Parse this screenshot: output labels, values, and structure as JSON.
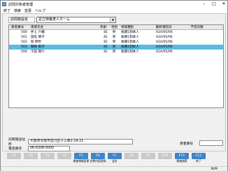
{
  "window": {
    "title": "訪問対象者管理"
  },
  "menu": [
    "終了",
    "検索",
    "変更",
    "ヘルプ"
  ],
  "facility": {
    "label": "訪問施設名",
    "value": "足立特養老人ホーム"
  },
  "grid": {
    "columns": [
      "患者番号",
      "患者氏名",
      "年齢",
      "性別",
      "保険種別",
      "最終来院日",
      "予定日数"
    ],
    "rows": [
      {
        "id": "500",
        "name": "井上 六輔",
        "age": "81",
        "sex": "男",
        "ins": "後期1割本人",
        "last": "H24/05/06",
        "next": ""
      },
      {
        "id": "501",
        "name": "田島 節子",
        "age": "81",
        "sex": "男",
        "ins": "後期1割本人",
        "last": "H24/05/06",
        "next": ""
      },
      {
        "id": "502",
        "name": "堀 明世",
        "age": "81",
        "sex": "男",
        "ins": "後期1割本人",
        "last": "H24/05/06",
        "next": ""
      },
      {
        "id": "503",
        "name": "関根 恵子",
        "age": "81",
        "sex": "男",
        "ins": "後期1割本人",
        "last": "H24/05/06",
        "next": ""
      },
      {
        "id": "504",
        "name": "千田 陽介",
        "age": "81",
        "sex": "男",
        "ins": "後期1割本人",
        "last": "H24/05/06",
        "next": ""
      }
    ],
    "selected_index": 3
  },
  "info": {
    "address_label": "訪問施設住所",
    "address_value": "大阪府大阪市淀川区十三東1-19-21",
    "phone_label": "電話番号",
    "phone_value": "06-6308-0000",
    "patient_no_label": "患者番号",
    "patient_no_value": ""
  },
  "fkeys": [
    {
      "key": "F1",
      "label": "",
      "active": false
    },
    {
      "key": "F2",
      "label": "",
      "active": false
    },
    {
      "key": "F3",
      "label": "",
      "active": false
    },
    {
      "key": "F4",
      "label": "",
      "active": false
    },
    {
      "key": "F5",
      "label": "患者情報変更",
      "active": true
    },
    {
      "key": "F6",
      "label": "診療内容登録",
      "active": true
    },
    {
      "key": "F7",
      "label": "会計",
      "active": true
    },
    {
      "key": "F8",
      "label": "",
      "active": false
    },
    {
      "key": "F9",
      "label": "",
      "active": false
    },
    {
      "key": "F10",
      "label": "",
      "active": false
    },
    {
      "key": "F11",
      "label": "患者検索",
      "active": true
    },
    {
      "key": "F12",
      "label": "終了",
      "active": true
    }
  ],
  "status": {
    "indicator": "NUM"
  },
  "colors": {
    "selection": "#5bb9e6",
    "fkey_active": "#3d86c8",
    "fkey_inactive": "#c9c9c9"
  }
}
